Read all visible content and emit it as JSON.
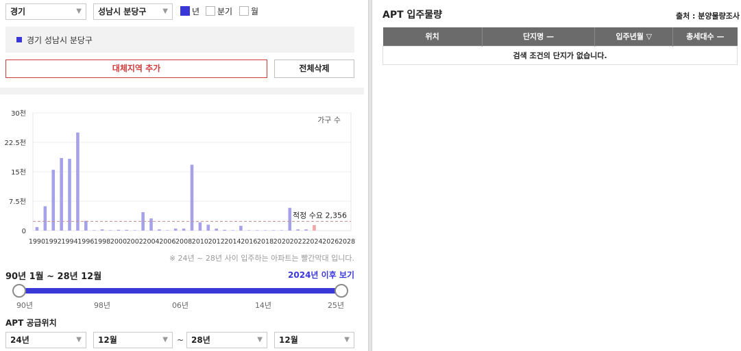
{
  "filters": {
    "province": "경기",
    "district": "성남시 분당구",
    "arrow": "▼",
    "period_options": [
      {
        "label": "년",
        "checked": true
      },
      {
        "label": "분기",
        "checked": false
      },
      {
        "label": "월",
        "checked": false
      }
    ]
  },
  "selected_region": "경기 성남시 분당구",
  "buttons": {
    "add_alternative": "대체지역 추가",
    "delete_all": "전체삭제"
  },
  "colors": {
    "accent": "#3a37d8",
    "bar": "#a6a2ea",
    "bar_future": "#f0a8a8",
    "alert": "#d03a3a"
  },
  "chart_data": {
    "type": "bar",
    "unit_label": "가구 수",
    "ylim": [
      0,
      30000
    ],
    "y_ticks": [
      {
        "value": 0,
        "label": "0"
      },
      {
        "value": 7500,
        "label": "7.5천"
      },
      {
        "value": 15000,
        "label": "15천"
      },
      {
        "value": 22500,
        "label": "22.5천"
      },
      {
        "value": 30000,
        "label": "30천"
      }
    ],
    "x_range": [
      1989.5,
      2028.5
    ],
    "x_tick_labels": [
      "1990",
      "1992",
      "1994",
      "1996",
      "1998",
      "2000",
      "2002",
      "2004",
      "2006",
      "2008",
      "2010",
      "2012",
      "2014",
      "2016",
      "2018",
      "2020",
      "2022",
      "2024",
      "2026",
      "2028"
    ],
    "values": [
      {
        "year": 1990,
        "value": 900
      },
      {
        "year": 1991,
        "value": 6200
      },
      {
        "year": 1992,
        "value": 15500
      },
      {
        "year": 1993,
        "value": 18500
      },
      {
        "year": 1994,
        "value": 18300
      },
      {
        "year": 1995,
        "value": 25000
      },
      {
        "year": 1996,
        "value": 2500
      },
      {
        "year": 1997,
        "value": 100
      },
      {
        "year": 1998,
        "value": 300
      },
      {
        "year": 1999,
        "value": 100
      },
      {
        "year": 2000,
        "value": 200
      },
      {
        "year": 2001,
        "value": 200
      },
      {
        "year": 2002,
        "value": 100
      },
      {
        "year": 2003,
        "value": 4700
      },
      {
        "year": 2004,
        "value": 3100
      },
      {
        "year": 2005,
        "value": 300
      },
      {
        "year": 2006,
        "value": 100
      },
      {
        "year": 2007,
        "value": 500
      },
      {
        "year": 2008,
        "value": 500
      },
      {
        "year": 2009,
        "value": 16800
      },
      {
        "year": 2010,
        "value": 2100
      },
      {
        "year": 2011,
        "value": 1500
      },
      {
        "year": 2012,
        "value": 500
      },
      {
        "year": 2013,
        "value": 200
      },
      {
        "year": 2014,
        "value": 100
      },
      {
        "year": 2015,
        "value": 1200
      },
      {
        "year": 2016,
        "value": 100
      },
      {
        "year": 2017,
        "value": 100
      },
      {
        "year": 2018,
        "value": 100
      },
      {
        "year": 2019,
        "value": 100
      },
      {
        "year": 2020,
        "value": 100
      },
      {
        "year": 2021,
        "value": 5800
      },
      {
        "year": 2022,
        "value": 300
      },
      {
        "year": 2023,
        "value": 300
      },
      {
        "year": 2024,
        "value": 1400,
        "future": true
      }
    ],
    "reference_line": {
      "value": 2356,
      "label": "적정 수요 2,356"
    },
    "grid": true
  },
  "chart_note": "※ 24년 ~ 28년 사이 입주하는 아파트는 빨간막대 입니다.",
  "range": {
    "title": "90년 1월 ~ 28년 12월",
    "after_link": "2024년 이후 보기",
    "ticks": [
      "90년",
      "98년",
      "06년",
      "14년",
      "25년"
    ]
  },
  "supply": {
    "title": "APT 공급위치",
    "from_year": "24년",
    "from_month": "12월",
    "tilde": "~",
    "to_year": "28년",
    "to_month": "12월"
  },
  "right_panel": {
    "title": "APT 입주물량",
    "source": "출처 : 분양물량조사",
    "columns": [
      "위치",
      "단지명 —",
      "입주년월 ▽",
      "총세대수 —"
    ],
    "empty_message": "검색 조건의 단지가 없습니다."
  }
}
